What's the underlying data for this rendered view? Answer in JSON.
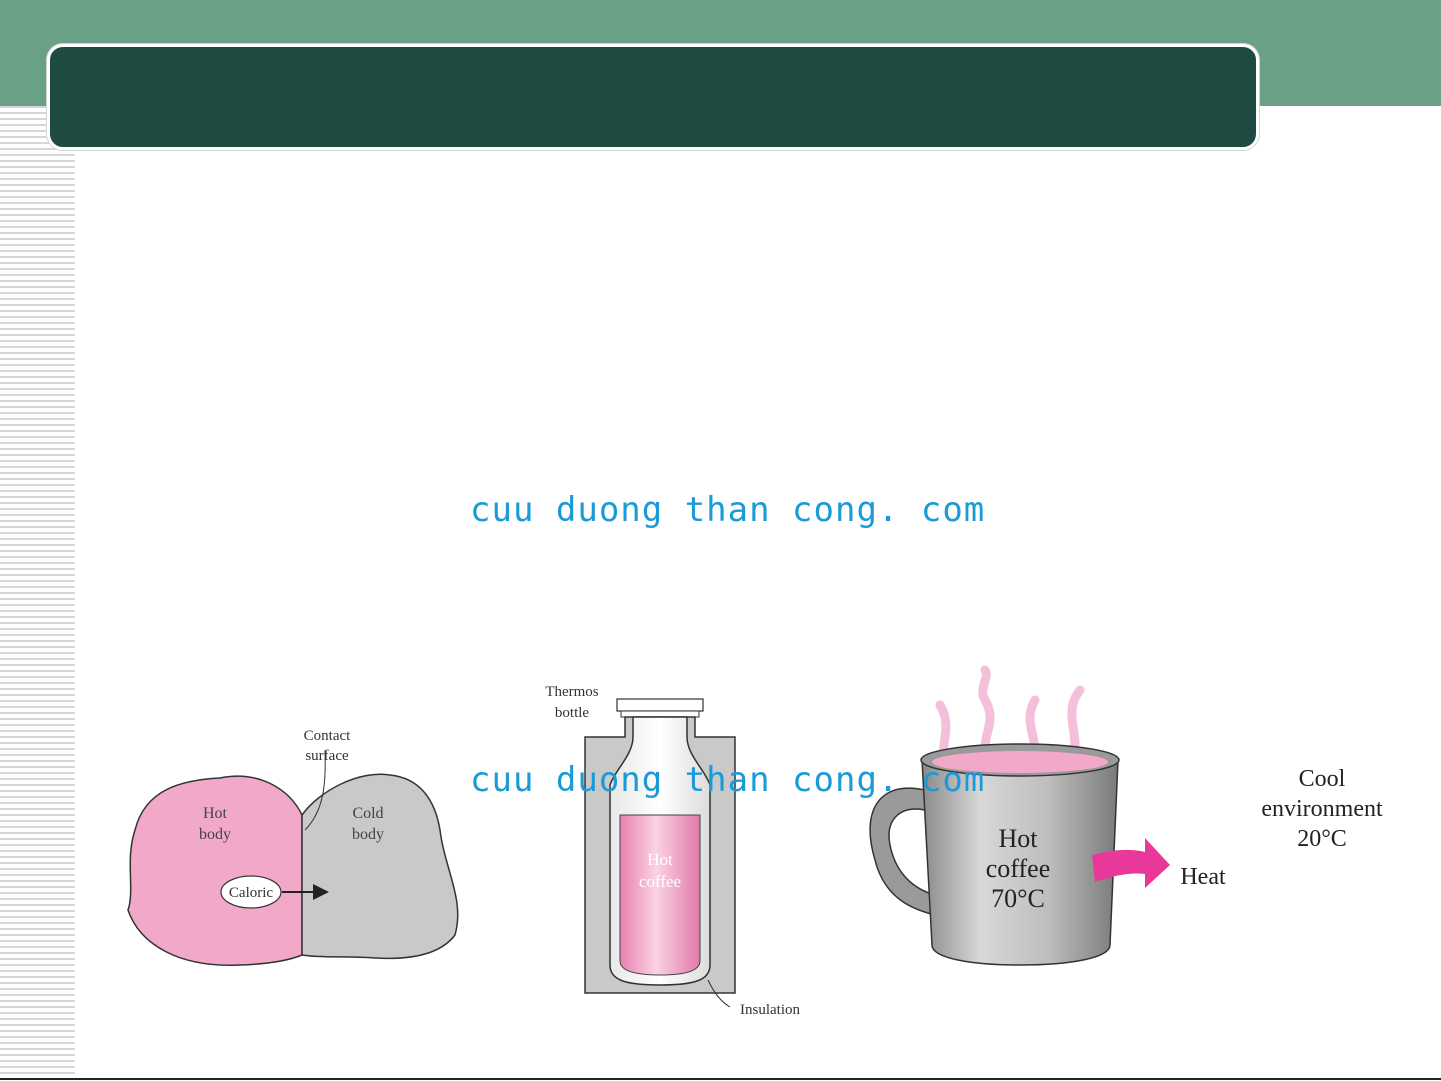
{
  "slide": {
    "title": "",
    "watermarks": [
      "cuu duong than cong. com",
      "cuu duong than cong. com"
    ],
    "colors": {
      "top_band": "#6aa085",
      "title_bg": "#1f4a42",
      "watermark": "#1b9ad8",
      "pink": "#f2a9c9",
      "gray": "#c9c9c9",
      "heat_arrow": "#e8399a"
    }
  },
  "figure_caloric": {
    "contact_label_1": "Contact",
    "contact_label_2": "surface",
    "hot_label_1": "Hot",
    "hot_label_2": "body",
    "cold_label_1": "Cold",
    "cold_label_2": "body",
    "caloric_label": "Caloric"
  },
  "figure_thermos": {
    "thermos_label_1": "Thermos",
    "thermos_label_2": "bottle",
    "coffee_label_1": "Hot",
    "coffee_label_2": "coffee",
    "insulation_label": "Insulation"
  },
  "figure_mug": {
    "coffee_label_1": "Hot",
    "coffee_label_2": "coffee",
    "coffee_temp": "70°C",
    "heat_label": "Heat",
    "env_label_1": "Cool",
    "env_label_2": "environment",
    "env_temp": "20°C"
  }
}
